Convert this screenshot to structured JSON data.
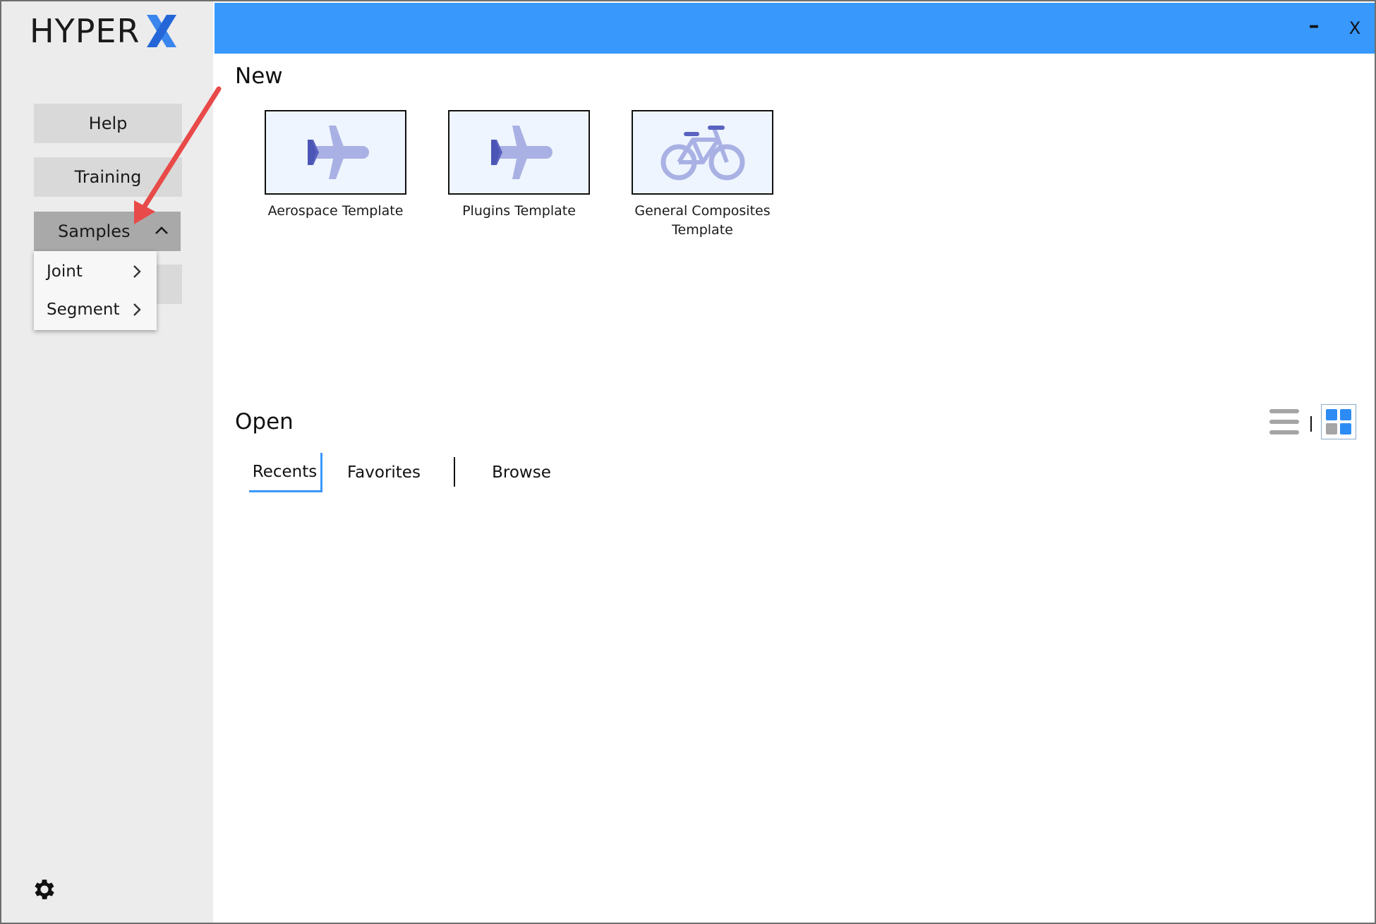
{
  "app": {
    "logo_text": "HYPER",
    "logo_x_color": "#2f7de1",
    "accent": "#3898fc"
  },
  "window": {
    "minimize_label": "–",
    "close_label": "X"
  },
  "sidebar": {
    "items": [
      {
        "label": "Help"
      },
      {
        "label": "Training"
      },
      {
        "label": "Samples",
        "expanded": true
      }
    ],
    "samples_menu": [
      {
        "label": "Joint",
        "icon": "chevron-right-icon"
      },
      {
        "label": "Segment",
        "icon": "chevron-right-icon"
      }
    ],
    "settings_icon": "gear-icon"
  },
  "new_section": {
    "title": "New",
    "templates": [
      {
        "label": "Aerospace Template",
        "icon": "airplane-icon"
      },
      {
        "label": "Plugins Template",
        "icon": "airplane-icon"
      },
      {
        "label": "General Composites Template",
        "icon": "bicycle-icon"
      }
    ]
  },
  "open_section": {
    "title": "Open",
    "tabs": [
      {
        "label": "Recents",
        "active": true
      },
      {
        "label": "Favorites",
        "active": false
      },
      {
        "label": "Browse",
        "active": false
      }
    ],
    "view_modes": [
      {
        "name": "list-view-icon",
        "active": false
      },
      {
        "name": "grid-view-icon",
        "active": true
      }
    ]
  },
  "annotation": {
    "arrow_color": "#e84a4a",
    "points_to": "Samples"
  }
}
